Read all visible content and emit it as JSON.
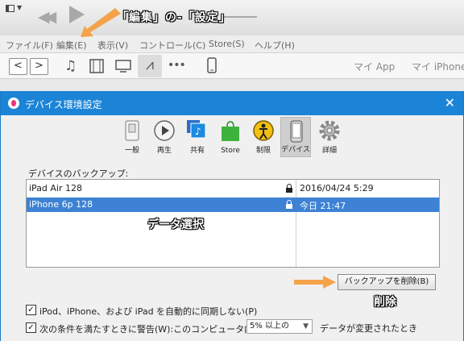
{
  "colors": {
    "accent": "#1c84d6",
    "selection": "#3d82d4",
    "annotation_arrow": "#f5a34a"
  },
  "annotations": {
    "edit_settings": "「編集」の-「設定」",
    "data_select": "データ選択",
    "delete": "削除"
  },
  "menubar": {
    "items": [
      "ファイル(F)",
      "編集(E)",
      "表示(V)",
      "コントロール(C)",
      "Store(S)",
      "ヘルプ(H)"
    ]
  },
  "navbar": {
    "back": "<",
    "forward": ">",
    "icons": [
      "music-icon",
      "film-icon",
      "tv-icon",
      "apps-icon",
      "more-icon",
      "phone-icon"
    ],
    "more": "•••",
    "tabs": [
      "マイ App",
      "マイ iPhone"
    ]
  },
  "dialog": {
    "title": "デバイス環境設定",
    "close": "✕",
    "toolbar": [
      {
        "label": "一般",
        "icon": "general-switch-icon"
      },
      {
        "label": "再生",
        "icon": "play-icon"
      },
      {
        "label": "共有",
        "icon": "sharing-icon"
      },
      {
        "label": "Store",
        "icon": "store-bag-icon"
      },
      {
        "label": "制限",
        "icon": "restrictions-icon"
      },
      {
        "label": "デバイス",
        "icon": "device-icon",
        "active": true
      },
      {
        "label": "詳細",
        "icon": "gear-icon"
      }
    ],
    "backups_label": "デバイスのバックアップ:",
    "backups": [
      {
        "name": "iPad Air 128",
        "date": "2016/04/24 5:29",
        "selected": false
      },
      {
        "name": "iPhone 6p 128",
        "date": "今日 21:47",
        "selected": true
      }
    ],
    "delete_button": "バックアップを削除(B)",
    "option_sync": "iPod、iPhone、および iPad を自動的に同期しない(P)",
    "option_warn": "次の条件を満たすときに警告(W):このコンピュータ内の",
    "threshold_value": "5% 以上の",
    "option_warn_tail": "データが変更されたとき",
    "sync_checked": true,
    "warn_checked": true
  }
}
